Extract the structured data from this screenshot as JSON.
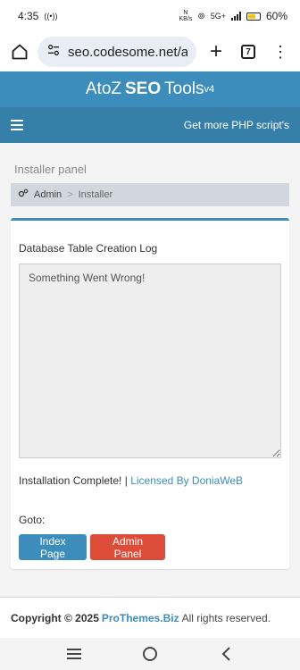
{
  "status_bar": {
    "time": "4:35",
    "net_top": "N",
    "net_bottom": "KB/s",
    "network": "5G+",
    "battery": "60%",
    "battery_level": 0.6
  },
  "browser": {
    "url": "seo.codesome.net/ad",
    "tab_count": "7"
  },
  "site": {
    "title_pre": "AtoZ",
    "title_bold": "SEO",
    "title_post": "Tools",
    "title_version": "v4",
    "nav_link": "Get more PHP script's"
  },
  "page": {
    "title": "Installer panel",
    "breadcrumb": [
      "Admin",
      ">",
      "Installer"
    ]
  },
  "panel": {
    "log_label": "Database Table Creation Log",
    "log_text": "Something Went Wrong!",
    "complete_text": "Installation Complete! |",
    "license_link": "Licensed By DoniaWeB",
    "goto_label": "Goto:",
    "btn_index": "Index Page",
    "btn_admin": "Admin Panel"
  },
  "footer": {
    "copyright": "Copyright © 2025",
    "brand": "ProThemes.Biz",
    "rights": "All rights reserved."
  },
  "colors": {
    "primary": "#3c8dbc",
    "navbar": "#367fa9",
    "danger": "#dd4b39"
  }
}
